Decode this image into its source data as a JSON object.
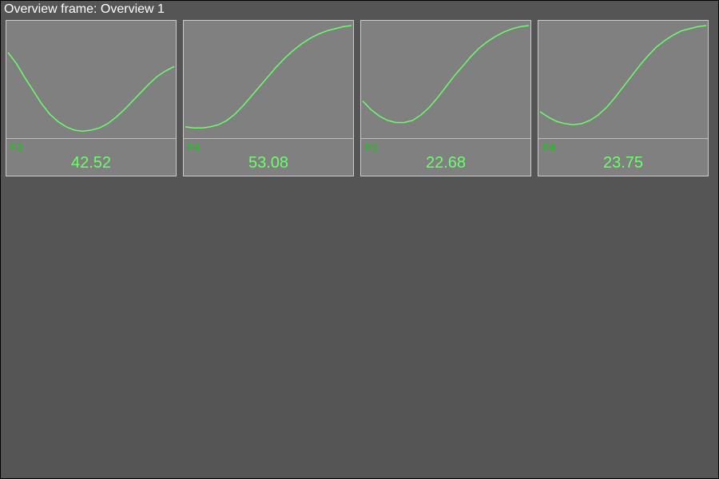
{
  "frame_title": "Overview frame: Overview 1",
  "colors": {
    "line": "#6aff6a",
    "label": "#1fbf1f",
    "value": "#6aff6a",
    "background": "#555555",
    "panel": "#808080"
  },
  "channels": [
    {
      "label": "F3",
      "value": "42.52"
    },
    {
      "label": "F4",
      "value": "53.08"
    },
    {
      "label": "P3",
      "value": "22.68"
    },
    {
      "label": "P4",
      "value": "23.75"
    }
  ],
  "chart_data": [
    {
      "type": "line",
      "title": "F3",
      "x": [
        0,
        1,
        2,
        3,
        4,
        5,
        6,
        7,
        8,
        9,
        10,
        11,
        12,
        13,
        14,
        15,
        16,
        17,
        18,
        19,
        20
      ],
      "values": [
        0.75,
        0.65,
        0.52,
        0.4,
        0.28,
        0.18,
        0.11,
        0.06,
        0.03,
        0.02,
        0.03,
        0.05,
        0.09,
        0.15,
        0.22,
        0.3,
        0.38,
        0.46,
        0.53,
        0.58,
        0.62
      ],
      "xlim": [
        0,
        20
      ],
      "ylim": [
        0,
        1
      ]
    },
    {
      "type": "line",
      "title": "F4",
      "x": [
        0,
        1,
        2,
        3,
        4,
        5,
        6,
        7,
        8,
        9,
        10,
        11,
        12,
        13,
        14,
        15,
        16,
        17,
        18,
        19,
        20
      ],
      "values": [
        0.06,
        0.05,
        0.05,
        0.06,
        0.08,
        0.12,
        0.18,
        0.26,
        0.35,
        0.44,
        0.53,
        0.62,
        0.7,
        0.77,
        0.83,
        0.88,
        0.92,
        0.95,
        0.97,
        0.99,
        1.0
      ],
      "xlim": [
        0,
        20
      ],
      "ylim": [
        0,
        1
      ]
    },
    {
      "type": "line",
      "title": "P3",
      "x": [
        0,
        1,
        2,
        3,
        4,
        5,
        6,
        7,
        8,
        9,
        10,
        11,
        12,
        13,
        14,
        15,
        16,
        17,
        18,
        19,
        20
      ],
      "values": [
        0.3,
        0.22,
        0.16,
        0.12,
        0.1,
        0.1,
        0.12,
        0.17,
        0.24,
        0.33,
        0.43,
        0.53,
        0.62,
        0.71,
        0.79,
        0.85,
        0.9,
        0.94,
        0.97,
        0.99,
        1.0
      ],
      "xlim": [
        0,
        20
      ],
      "ylim": [
        0,
        1
      ]
    },
    {
      "type": "line",
      "title": "P4",
      "x": [
        0,
        1,
        2,
        3,
        4,
        5,
        6,
        7,
        8,
        9,
        10,
        11,
        12,
        13,
        14,
        15,
        16,
        17,
        18,
        19,
        20
      ],
      "values": [
        0.2,
        0.15,
        0.11,
        0.09,
        0.08,
        0.09,
        0.12,
        0.17,
        0.24,
        0.33,
        0.43,
        0.53,
        0.63,
        0.72,
        0.8,
        0.86,
        0.91,
        0.95,
        0.97,
        0.99,
        1.0
      ],
      "xlim": [
        0,
        20
      ],
      "ylim": [
        0,
        1
      ]
    }
  ]
}
